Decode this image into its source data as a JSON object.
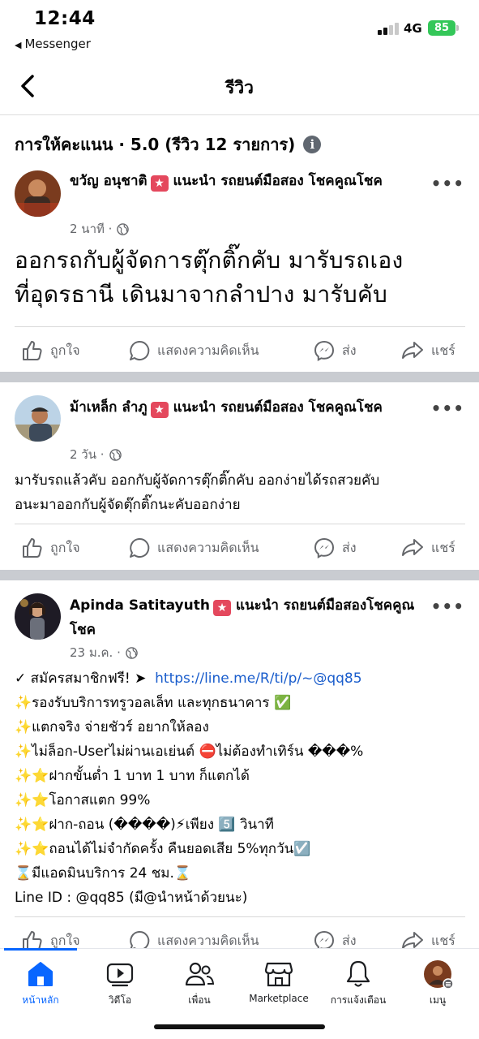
{
  "status_bar": {
    "time": "12:44",
    "back_app": "Messenger",
    "network": "4G",
    "battery": "85"
  },
  "header": {
    "title": "รีวิว"
  },
  "rating": {
    "text": "การให้คะแนน · 5.0 (รีวิว 12 รายการ)"
  },
  "posts": [
    {
      "author": "ขวัญ อนุชาติ",
      "recommends": "แนะนำ รถยนต์มือสอง โชคคูณโชค",
      "time": "2 นาที ·",
      "lines": [
        "ออกรถกับผู้จัดการตุ๊กติ๊กคับ มารับรถเอง",
        "ที่อุดรธานี เดินมาจากลำปาง มารับคับ"
      ]
    },
    {
      "author": "ม้าเหล็ก ลำภู",
      "recommends": "แนะนำ รถยนต์มือสอง โชคคูณโชค",
      "time": "2 วัน ·",
      "lines": [
        "มารับรถแล้วคับ ออกกับผู้จัดการตุ๊กติ๊กคับ ออกง่ายได้รถสวยคับ",
        "อนะมาออกกับผู้จัดตุ๊กติ๊กนะคับออกง่าย"
      ]
    },
    {
      "author": "Apinda Satitayuth",
      "recommends": "แนะนำ รถยนต์มือสองโชคคูณโชค",
      "time": "23 ม.ค. ·",
      "line1_prefix": "✓ สมัครสมาชิกฟรี! ➤",
      "link": "https://line.me/R/ti/p/~@qq85",
      "lines": [
        "✨รองรับบริการทรูวอลเล็ท และทุกธนาคาร ✅",
        "✨แตกจริง จ่ายชัวร์ อยากให้ลอง",
        "✨ไม่ล็อก-Userไม่ผ่านเอเย่นต์ ⛔ไม่ต้องทำเทิร์น ���%",
        "✨⭐ฝากขั้นต่ำ 1 บาท 1 บาท ก็แตกได้",
        "✨⭐โอกาสแตก 99%",
        "✨⭐ฝาก-ถอน (����)⚡เพียง 5️⃣ วินาที",
        "✨⭐ถอนได้ไม่จำกัดครั้ง คืนยอดเสีย 5%ทุกวัน☑️",
        "⌛มีแอดมินบริการ 24 ชม.⌛",
        "Line ID : @qq85 (มี@นำหน้าด้วยนะ)"
      ]
    }
  ],
  "actions": {
    "like": "ถูกใจ",
    "comment": "แสดงความคิดเห็น",
    "send": "ส่ง",
    "share": "แชร์"
  },
  "bottom_nav": {
    "home": "หน้าหลัก",
    "video": "วิดีโอ",
    "friends": "เพื่อน",
    "marketplace": "Marketplace",
    "notifications": "การแจ้งเตือน",
    "menu": "เมนู"
  },
  "colors": {
    "accent": "#0866ff",
    "badge": "#e4485d",
    "link": "#1a5dcc",
    "battery": "#34c759"
  },
  "icons": [
    "back-arrow-icon",
    "info-icon",
    "star-badge-icon",
    "globe-icon",
    "more-icon",
    "like-icon",
    "comment-icon",
    "messenger-icon",
    "share-icon",
    "home-icon",
    "video-icon",
    "friends-icon",
    "marketplace-icon",
    "bell-icon"
  ]
}
